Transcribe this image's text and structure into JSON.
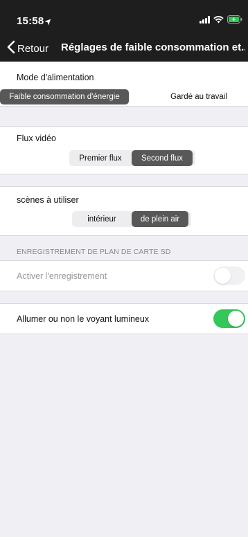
{
  "status_bar": {
    "time": "15:58"
  },
  "nav": {
    "back_label": "Retour",
    "title": "Réglages de faible consommation et..."
  },
  "power_mode": {
    "label": "Mode d'alimentation",
    "options": [
      "Faible consommation d'énergie",
      "Gardé au travail"
    ],
    "selected": "Faible consommation d'énergie"
  },
  "video_stream": {
    "label": "Flux vidéo",
    "options": [
      "Premier flux",
      "Second flux"
    ],
    "selected": "Second flux"
  },
  "scene": {
    "label": "scènes à utiliser",
    "options": [
      "intérieur",
      "de plein air"
    ],
    "selected": "de plein air"
  },
  "sd_recording": {
    "header": "ENREGISTREMENT DE PLAN DE CARTE SD",
    "enable_label": "Activer l'enregistrement",
    "enabled": false
  },
  "indicator_light": {
    "label": "Allumer ou non le voyant lumineux",
    "enabled": true
  },
  "colors": {
    "accent_green": "#34c759",
    "selected_segment": "#585858",
    "nav_background": "#1e1e1e"
  }
}
